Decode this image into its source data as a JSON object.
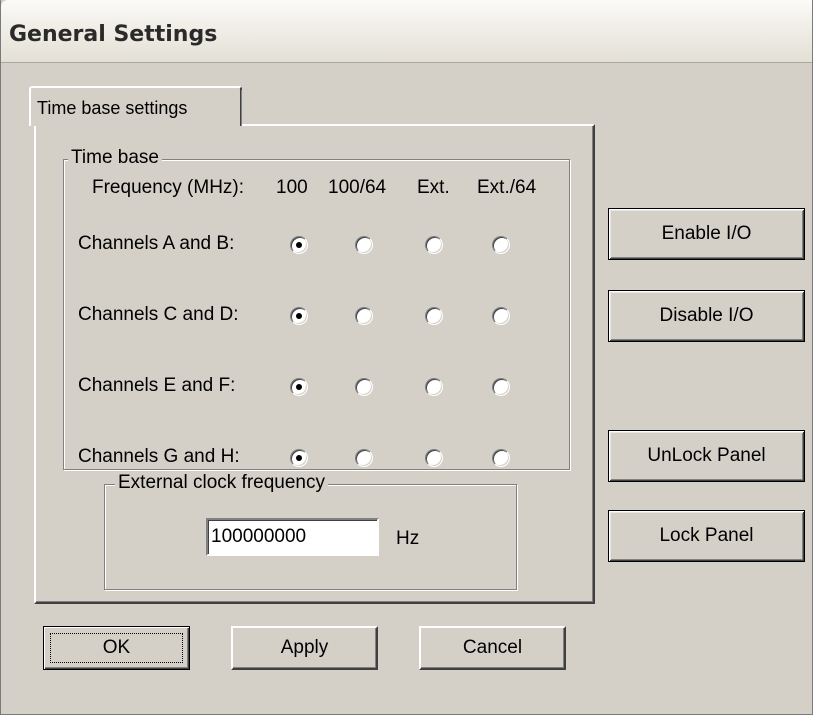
{
  "window": {
    "title": "General Settings"
  },
  "tabs": [
    {
      "label": "Time base settings",
      "selected": true
    }
  ],
  "timebase": {
    "group_label": "Time base",
    "columns": [
      "Frequency (MHz):",
      "100",
      "100/64",
      "Ext.",
      "Ext./64"
    ],
    "rows": [
      {
        "label": "Channels A and B:",
        "selected_index": 0
      },
      {
        "label": "Channels C and D:",
        "selected_index": 0
      },
      {
        "label": "Channels E and F:",
        "selected_index": 0
      },
      {
        "label": "Channels G and H:",
        "selected_index": 0
      }
    ]
  },
  "external_clock": {
    "group_label": "External clock frequency",
    "value": "100000000",
    "unit": "Hz"
  },
  "buttons": {
    "enable_io": "Enable I/O",
    "disable_io": "Disable I/O",
    "unlock_panel": "UnLock Panel",
    "lock_panel": "Lock Panel",
    "ok": "OK",
    "apply": "Apply",
    "cancel": "Cancel"
  },
  "colors": {
    "dialog_face": "#d4d0c8",
    "title_gradient_top": "#fbfbf9",
    "title_gradient_bottom": "#e3e0d6"
  }
}
